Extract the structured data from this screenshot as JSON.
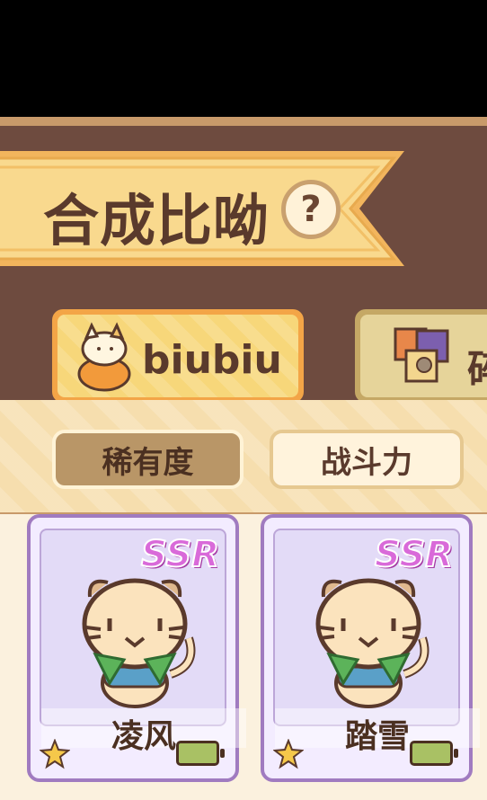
{
  "header": {
    "title": "合成比呦",
    "help_icon": "?"
  },
  "tabs": [
    {
      "label": "biubiu",
      "active": true
    },
    {
      "label": "碎",
      "active": false
    }
  ],
  "sort": {
    "options": [
      "稀有度",
      "战斗力"
    ],
    "selected": "稀有度"
  },
  "cards": [
    {
      "rarity": "SSR",
      "name": "凌风",
      "stars": 1
    },
    {
      "rarity": "SSR",
      "name": "踏雪",
      "stars": 1
    }
  ],
  "colors": {
    "brown": "#6e4b3f",
    "banner": "#f6cf79",
    "card_border": "#a07bc0",
    "rarity": "#d96ad9"
  },
  "icons": {
    "help": "question-icon",
    "tab1": "cat-stack-icon",
    "tab2": "fragments-icon",
    "star": "star-icon",
    "battery": "battery-icon"
  }
}
